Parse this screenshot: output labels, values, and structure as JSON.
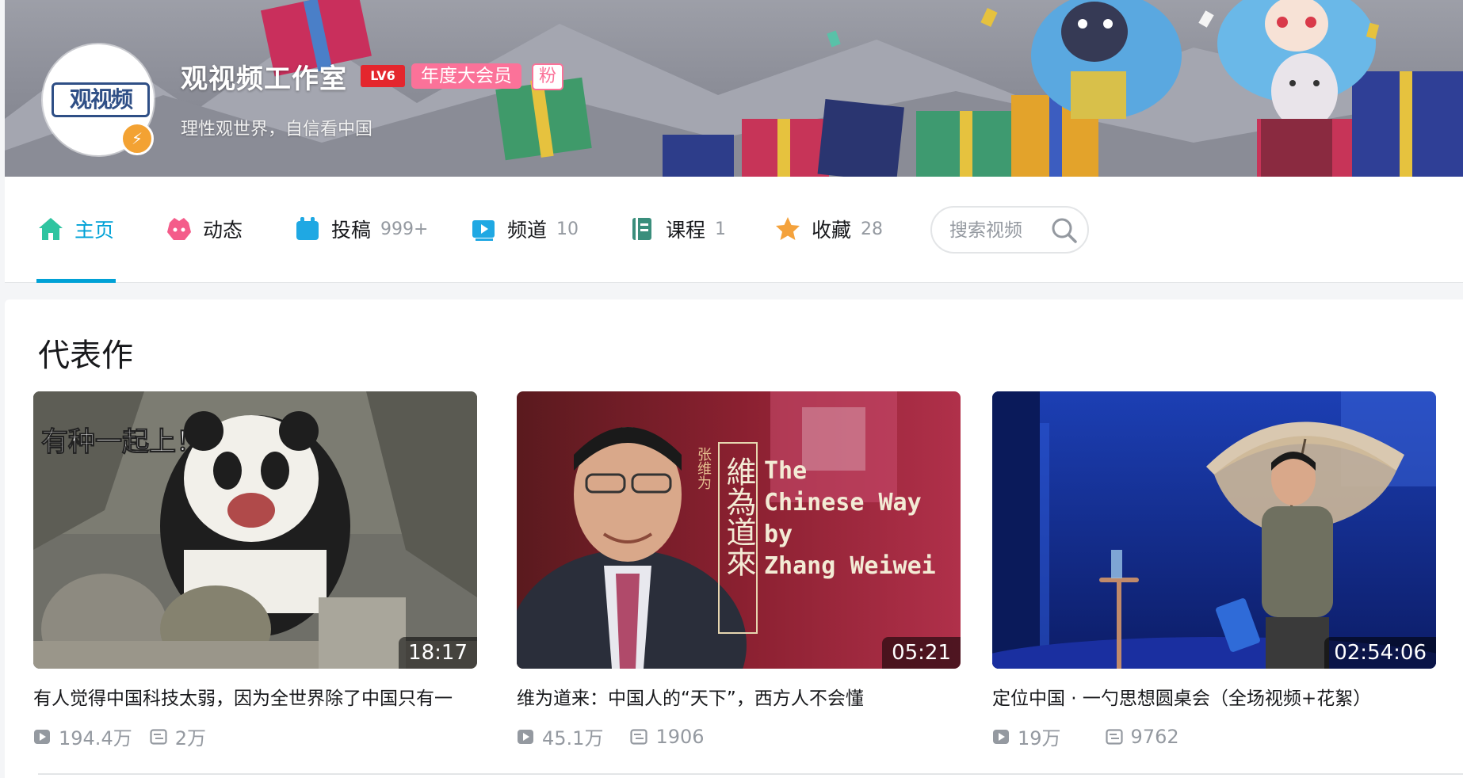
{
  "profile": {
    "name": "观视频工作室",
    "level": "LV6",
    "vip_label": "年度大会员",
    "fan_label": "粉",
    "sign": "理性观世界，自信看中国",
    "avatar_text": "观视频"
  },
  "nav": {
    "tabs": [
      {
        "label": "主页",
        "count": "",
        "icon": "home-icon",
        "active": true
      },
      {
        "label": "动态",
        "count": "",
        "icon": "dynamic-icon"
      },
      {
        "label": "投稿",
        "count": "999+",
        "icon": "upload-icon"
      },
      {
        "label": "频道",
        "count": "10",
        "icon": "channel-icon"
      },
      {
        "label": "课程",
        "count": "1",
        "icon": "course-icon"
      },
      {
        "label": "收藏",
        "count": "28",
        "icon": "favorite-icon"
      }
    ],
    "search_placeholder": "搜索视频"
  },
  "section": {
    "title": "代表作"
  },
  "videos": [
    {
      "title": "有人觉得中国科技太弱，因为全世界除了中国只有一",
      "duration": "18:17",
      "views": "194.4万",
      "danmaku": "2万",
      "overlay_text": "有种一起上！"
    },
    {
      "title": "维为道来：中国人的“天下”，西方人不会懂",
      "duration": "05:21",
      "views": "45.1万",
      "danmaku": "1906",
      "overlay_cn_small": "张维为",
      "overlay_cn_big": "維為道來",
      "overlay_en_1": "The",
      "overlay_en_2": "Chinese Way",
      "overlay_en_3": "by",
      "overlay_en_4": "Zhang Weiwei"
    },
    {
      "title": "定位中国 · 一勺思想圆桌会（全场视频+花絮）",
      "duration": "02:54:06",
      "views": "19万",
      "danmaku": "9762"
    }
  ],
  "colors": {
    "accent": "#00a1d6",
    "vip_pink": "#fb7299",
    "level_red": "#e4262d",
    "text_gray": "#9499a0"
  }
}
